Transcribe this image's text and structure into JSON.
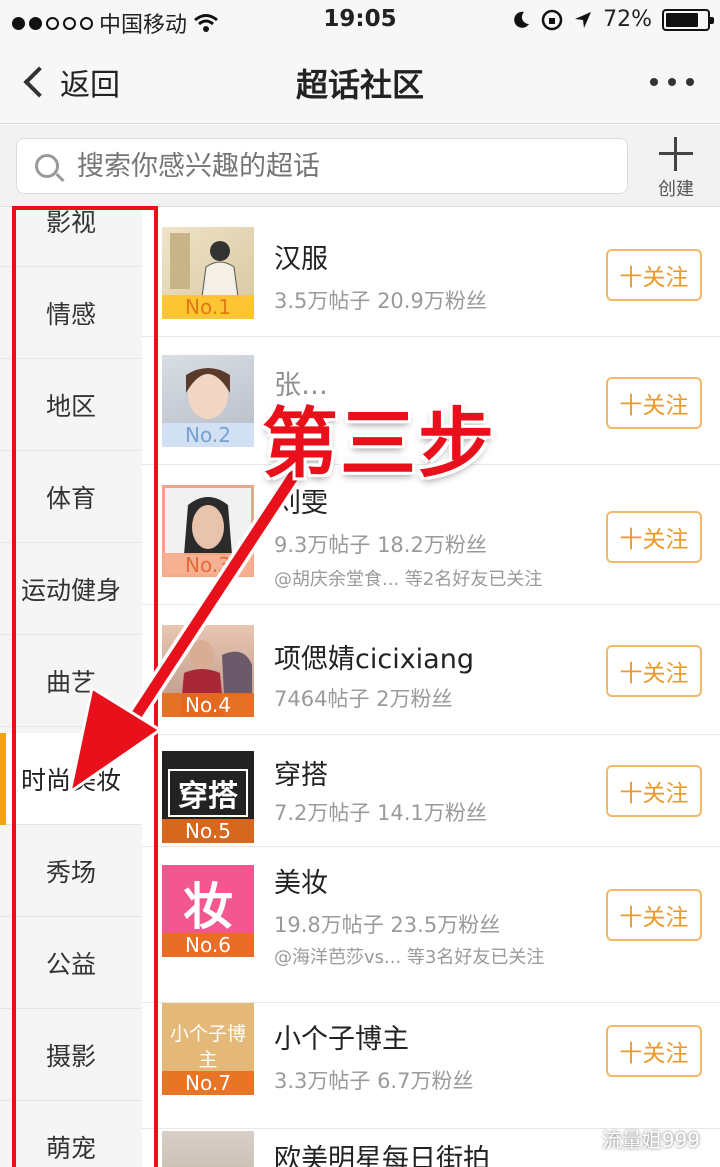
{
  "status": {
    "carrier": "中国移动",
    "time": "19:05",
    "battery": "72%"
  },
  "nav": {
    "back_label": "返回",
    "title": "超话社区"
  },
  "search": {
    "placeholder": "搜索你感兴趣的超话",
    "create_label": "创建"
  },
  "sidebar": {
    "items": [
      {
        "label": "影视"
      },
      {
        "label": "情感"
      },
      {
        "label": "地区"
      },
      {
        "label": "体育"
      },
      {
        "label": "运动健身"
      },
      {
        "label": "曲艺"
      },
      {
        "label": "时尚美妆"
      },
      {
        "label": "秀场"
      },
      {
        "label": "公益"
      },
      {
        "label": "摄影"
      },
      {
        "label": "萌宠"
      }
    ],
    "active": "时尚美妆"
  },
  "list": {
    "follow_label": "十关注",
    "items": [
      {
        "name": "汉服",
        "stats": "3.5万帖子 20.9万粉丝",
        "rank": "No.1",
        "friends": ""
      },
      {
        "name": "张…",
        "stats": "",
        "rank": "No.2",
        "friends": ""
      },
      {
        "name": "刘雯",
        "stats": "9.3万帖子 18.2万粉丝",
        "rank": "No.3",
        "friends": "@胡庆余堂食... 等2名好友已关注"
      },
      {
        "name": "项偲婧cicixiang",
        "stats": "7464帖子 2万粉丝",
        "rank": "No.4",
        "friends": ""
      },
      {
        "name": "穿搭",
        "stats": "7.2万帖子 14.1万粉丝",
        "rank": "No.5",
        "thumb_text": "穿搭",
        "friends": ""
      },
      {
        "name": "美妆",
        "stats": "19.8万帖子 23.5万粉丝",
        "rank": "No.6",
        "thumb_text": "妆",
        "friends": "@海洋芭莎vs... 等3名好友已关注"
      },
      {
        "name": "小个子博主",
        "stats": "3.3万帖子 6.7万粉丝",
        "rank": "No.7",
        "thumb_text": "小个子博主",
        "friends": ""
      },
      {
        "name": "欧美明星每日街拍",
        "stats": "",
        "rank": "",
        "friends": ""
      }
    ]
  },
  "annotation": {
    "step_label": "第三步"
  },
  "watermark": {
    "text": "流量姐999"
  },
  "colors": {
    "accent": "#f3a11a",
    "follow": "#ec9a2a",
    "annotation_red": "#e8111b"
  }
}
